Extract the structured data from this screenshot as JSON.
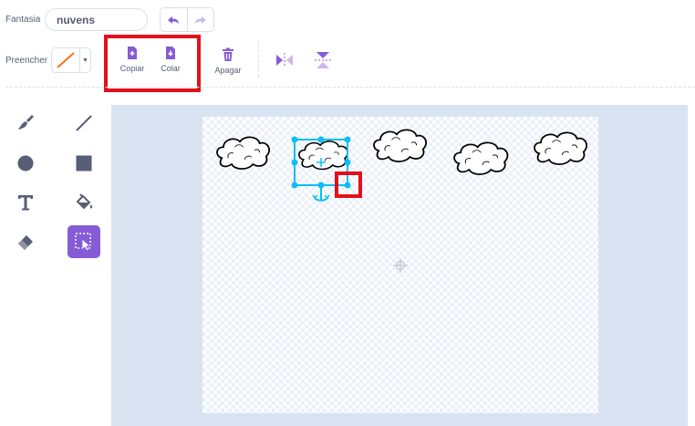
{
  "costume": {
    "label": "Fantasia",
    "name_value": "nuvens"
  },
  "fill": {
    "label": "Preencher",
    "color": "#ff6b1a"
  },
  "toolbar": {
    "copy_label": "Copiar",
    "paste_label": "Colar",
    "delete_label": "Apagar"
  },
  "colors": {
    "accent": "#855cd6",
    "highlight": "#e3101a",
    "selection": "#0fbdf5"
  }
}
